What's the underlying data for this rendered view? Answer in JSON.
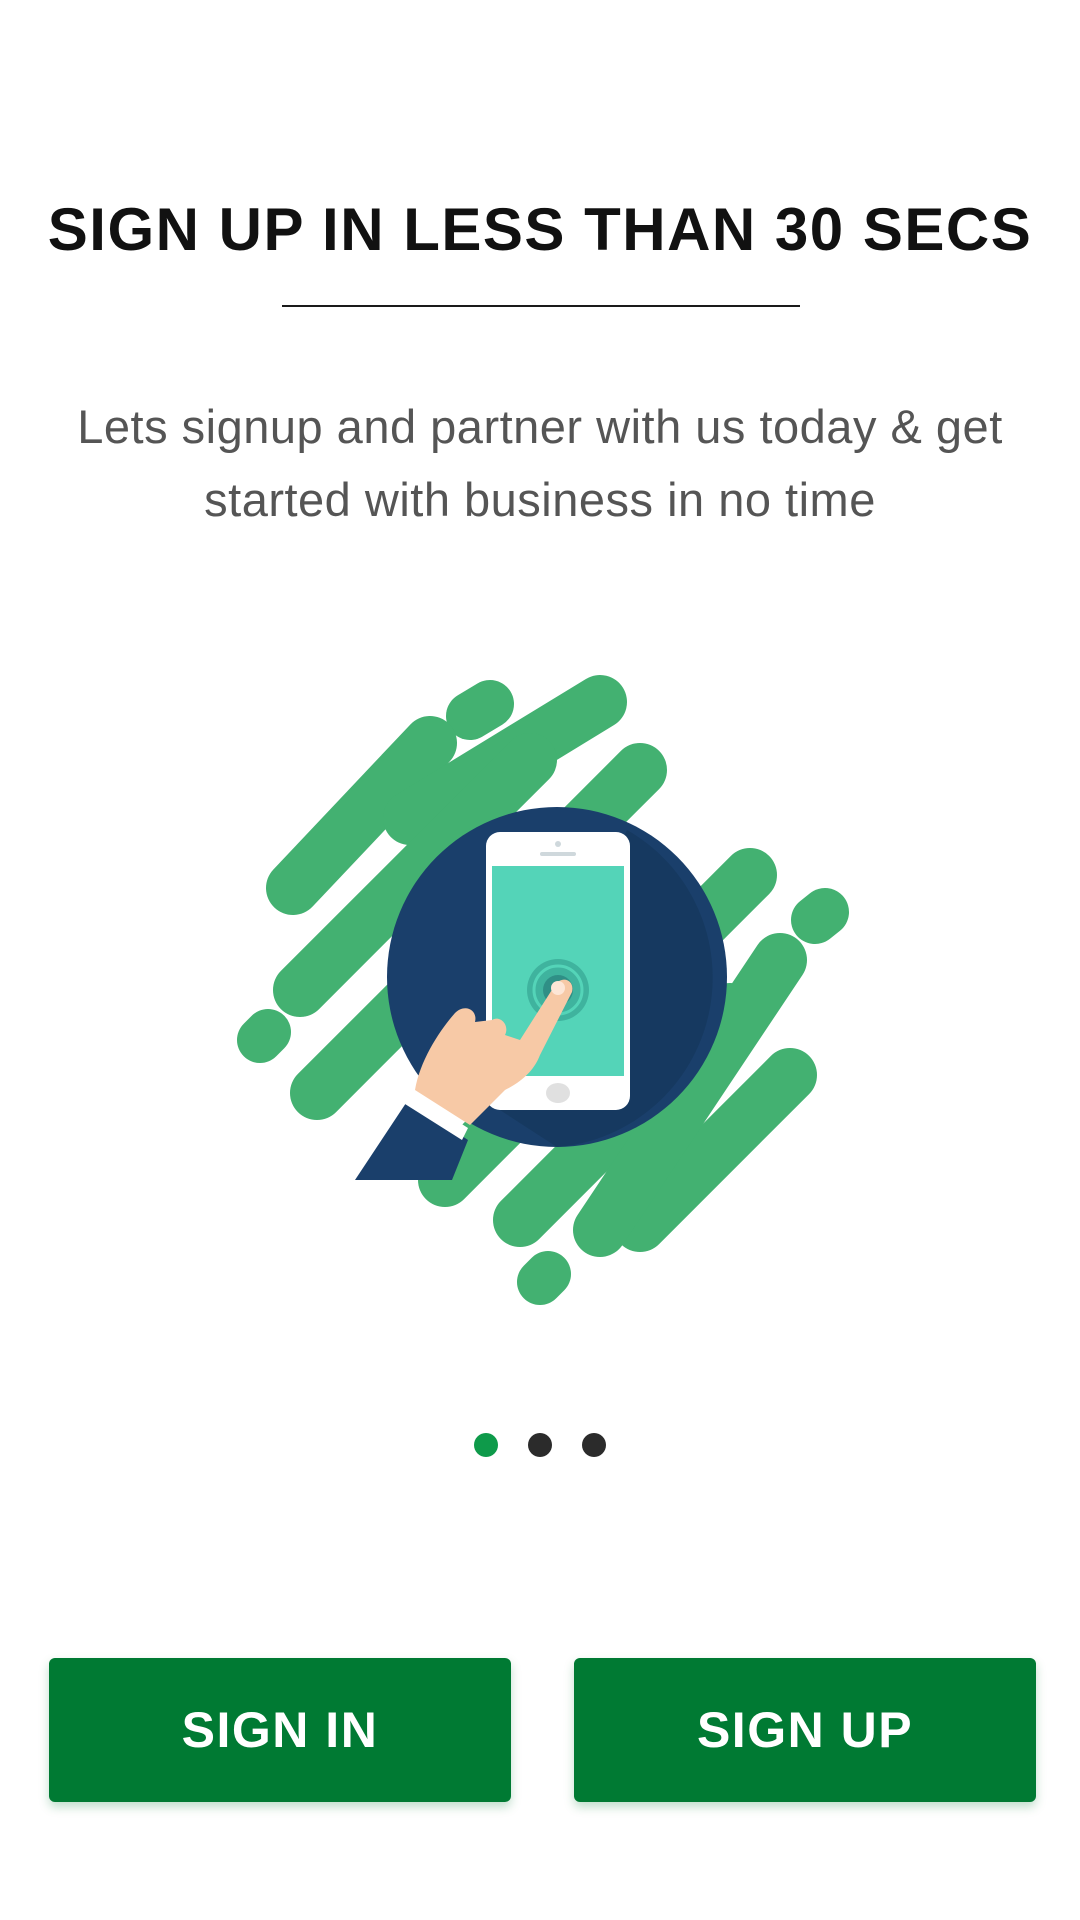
{
  "header": {
    "title": "SIGN UP IN LESS THAN 30 SECS",
    "subtitle": "Lets signup and partner with us today & get started with business in no time"
  },
  "illustration": {
    "icon": "phone-tap-icon"
  },
  "pager": {
    "count": 3,
    "active_index": 0
  },
  "actions": {
    "sign_in_label": "SIGN IN",
    "sign_up_label": "SIGN UP"
  },
  "colors": {
    "primary": "#007a33",
    "active_dot": "#0e9a4a",
    "inactive_dot": "#2b2b2b",
    "blob_green": "#43b171",
    "navy": "#1a3f6b",
    "screen_teal": "#54d4b8"
  }
}
